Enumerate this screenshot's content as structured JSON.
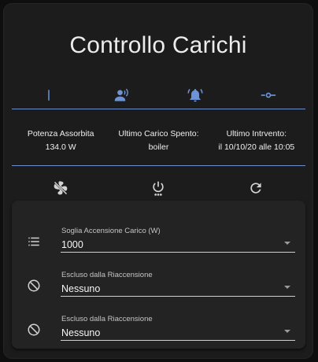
{
  "title": "Controllo Carichi",
  "colors": {
    "accent": "#6d8fc9",
    "icon_top": "#6b93d6",
    "icon_bottom": "#d2d2d2"
  },
  "top_icons": [
    "text-cursor-icon",
    "account-voice-icon",
    "bell-ring-icon",
    "source-commit-icon"
  ],
  "stats": [
    {
      "label": "Potenza Assorbita",
      "value": "134.0 W"
    },
    {
      "label": "Ultimo Carico Spento:",
      "value": "boiler"
    },
    {
      "label": "Ultimo Intrvento:",
      "value": "il 10/10/20 alle 10:05"
    }
  ],
  "action_icons": [
    "fan-off-icon",
    "power-settings-icon",
    "refresh-icon"
  ],
  "fields": [
    {
      "icon": "list-icon",
      "label": "Soglia Accensione Carico (W)",
      "value": "1000"
    },
    {
      "icon": "block-icon",
      "label": "Escluso dalla Riaccensione",
      "value": "Nessuno"
    },
    {
      "icon": "block-icon",
      "label": "Escluso dalla Riaccensione",
      "value": "Nessuno"
    }
  ]
}
